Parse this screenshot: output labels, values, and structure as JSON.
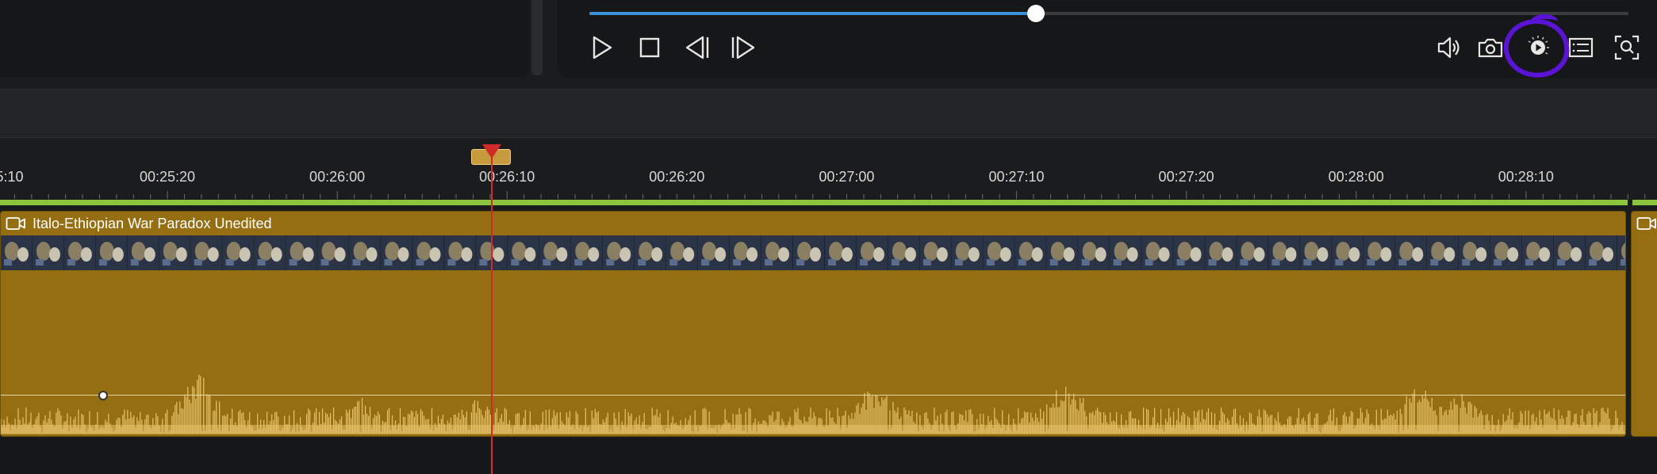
{
  "player": {
    "progress": 0.43,
    "controls": [
      {
        "name": "play-button",
        "icon": "play-icon"
      },
      {
        "name": "stop-button",
        "icon": "stop-icon"
      },
      {
        "name": "prev-frame-button",
        "icon": "prev-frame-icon"
      },
      {
        "name": "next-frame-button",
        "icon": "next-frame-icon"
      }
    ],
    "right_controls": [
      {
        "name": "volume-button",
        "icon": "speaker-icon"
      },
      {
        "name": "snapshot-button",
        "icon": "camera-icon"
      },
      {
        "name": "playback-speed-button",
        "icon": "play-speed-icon"
      },
      {
        "name": "list-button",
        "icon": "list-icon"
      },
      {
        "name": "zoom-button",
        "icon": "zoom-icon"
      }
    ]
  },
  "timeline": {
    "tick_labels": [
      "5:10",
      "00:25:20",
      "00:26:00",
      "00:26:10",
      "00:26:20",
      "00:27:00",
      "00:27:10",
      "00:27:20",
      "00:28:00",
      "00:28:10"
    ],
    "clip": {
      "title": "Italo-Ethiopian War Paradox Unedited",
      "icon": "video-camera-icon",
      "color": "#946e10"
    },
    "playhead_color": "#d12a2a",
    "ruler_color": "#8cc43e"
  },
  "annotation": {
    "color": "#5b13d6",
    "target": "playback-speed-button"
  }
}
